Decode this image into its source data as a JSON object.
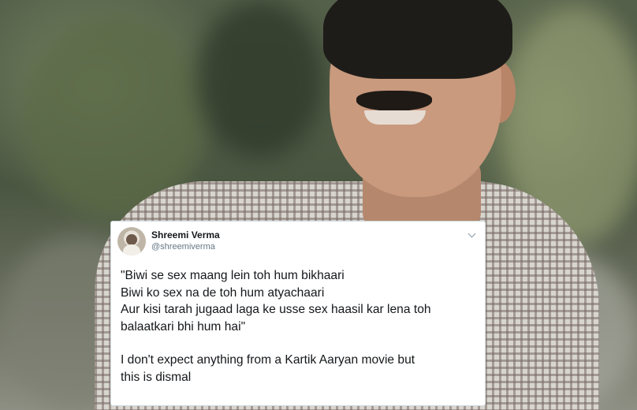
{
  "tweet": {
    "name": "Shreemi Verma",
    "handle": "@shreemiverma",
    "lines_quote": [
      "\"Biwi se sex maang lein toh hum bikhaari",
      "Biwi ko sex na de toh hum atyachaari",
      "Aur kisi tarah jugaad laga ke usse sex haasil kar lena toh",
      "balaatkari bhi hum hai\""
    ],
    "lines_comment": [
      "I don't expect anything from a Kartik Aaryan movie but",
      "this is dismal"
    ],
    "menu_icon": "chevron-down-icon",
    "avatar_icon": "avatar"
  },
  "colors": {
    "card_bg": "#ffffff",
    "text": "#14171a",
    "muted": "#657786"
  }
}
